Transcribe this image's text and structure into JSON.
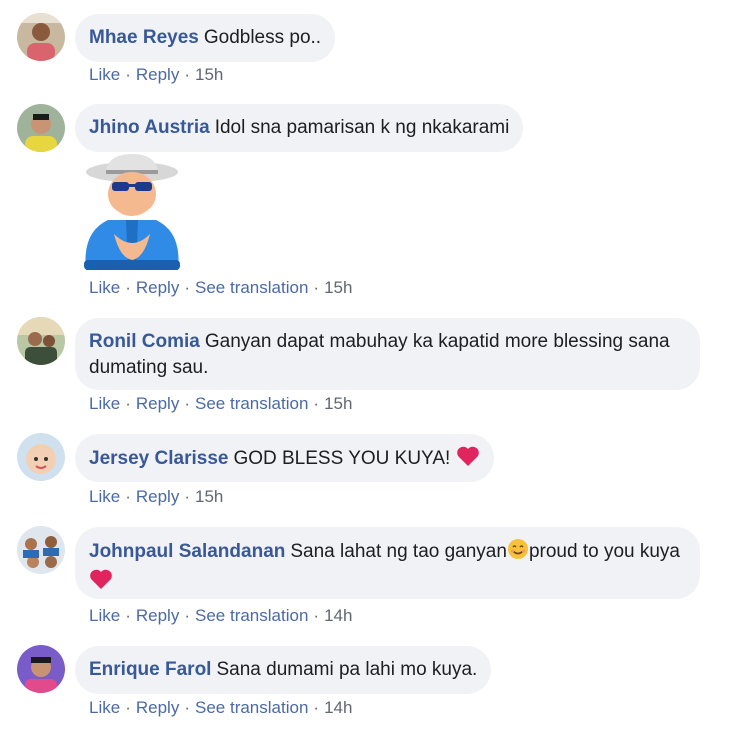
{
  "comments": [
    {
      "author": "Mhae Reyes",
      "text": "Godbless po..",
      "actions": {
        "like": "Like",
        "reply": "Reply",
        "time": "15h"
      }
    },
    {
      "author": "Jhino Austria",
      "text": "Idol sna pamarisan k ng nkakarami",
      "sticker": "clapping-old-man-sticker",
      "actions": {
        "like": "Like",
        "reply": "Reply",
        "translate": "See translation",
        "time": "15h"
      }
    },
    {
      "author": "Ronil Comia",
      "text": "Ganyan dapat mabuhay ka kapatid more blessing sana dumating sau.",
      "actions": {
        "like": "Like",
        "reply": "Reply",
        "translate": "See translation",
        "time": "15h"
      }
    },
    {
      "author": "Jersey Clarisse",
      "text": "GOD BLESS YOU KUYA!",
      "trailing_icon": "red-heart-icon",
      "actions": {
        "like": "Like",
        "reply": "Reply",
        "time": "15h"
      }
    },
    {
      "author": "Johnpaul Salandanan",
      "text_part1": "Sana lahat ng tao ganyan",
      "text_part2": "proud to you kuya",
      "inline_icons": [
        "smiling-face-icon",
        "red-heart-icon"
      ],
      "actions": {
        "like": "Like",
        "reply": "Reply",
        "translate": "See translation",
        "time": "14h"
      }
    },
    {
      "author": "Enrique Farol",
      "text": "Sana dumami pa lahi mo kuya.",
      "actions": {
        "like": "Like",
        "reply": "Reply",
        "translate": "See translation",
        "time": "14h"
      }
    }
  ],
  "colors": {
    "bubble": "#f0f2f5",
    "author": "#385898",
    "action": "#4b6aa5",
    "meta": "#606770",
    "heart": "#e0245e"
  },
  "separator": "·"
}
